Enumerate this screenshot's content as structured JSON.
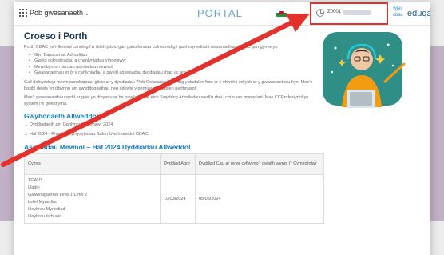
{
  "header": {
    "services_label": "Pob gwasanaeth",
    "portal_title": "PORTAL",
    "user_id": "Z0001",
    "wjec_logo": "wjec\ncbac",
    "eduqas_logo": "eduqas"
  },
  "main": {
    "heading": "Croeso i Porth",
    "intro": "Porth CBAC yw'r lleoliad canolog i'w ddefnyddio gan ganolfannau cofrestredig i gael mynediad i wasanaethau CBAC gan gynnwys:",
    "bullets": [
      "Gyn Bapurau ac Adnoddau",
      "Gweld cofrestriadau a chanlyniadau ymgeiswyr",
      "Mewnbynnu marciau asesiadau mewnol",
      "Gwasanaethau er ôl y canlyniadau a gweld agregiadau dyddiadau rhad ac am ddim."
    ],
    "para1": "Gall defnyddwyr mewn canolfannau gliciо ar y dyddiadau 'Pob Gwasanaeth' ar frig y dudalen fron ar y chwith i edrych ar y gwasanaethau hyn. Mae'n bosibl dewis yn dibynnu am swyddogaethau neu ddewis y pennawd dewislen perthnasol.",
    "para2": "Mae'r gwasanaethau sydd ar gael yn dibynnu ar ba hawliau mae eich Swyddog Arholiadau wedi'u rhoi i chi o ran mynediad. Mae CCProfesiynol yn system i'w gweld yma.",
    "important_heading": "Gwybodaeth Allweddol",
    "links": [
      "→ Dyddiadaeth am Ganlyniadau Ionawr 2024",
      "→ Haf 2024 - Rheolau cymysyteisau Safon Uwch unedol CBAC."
    ],
    "table_heading": "Asesiadau Mewnol – Haf 2024 Dyddiadau Allweddol",
    "table": {
      "headers": [
        "Cyfres",
        "Dyddiad Agor",
        "Dyddiad Cau ar gyfer cyflwyno'r gwaith sampl i'r Cymedrolwr"
      ],
      "row_items": [
        "TGAU*",
        "Lladin",
        "Galwedigaethol Lefel 1/Lefel 2",
        "Lefel Mynediad",
        "Lleybrau Mynediad",
        "Lleybrau Isrhuaid"
      ],
      "open_date": "10/03/2024",
      "close_date": "05/05/2024"
    }
  },
  "colors": {
    "annotation_red": "#e3312c",
    "heading_navy": "#1f3a52",
    "accent_blue": "#1a7fb8"
  }
}
